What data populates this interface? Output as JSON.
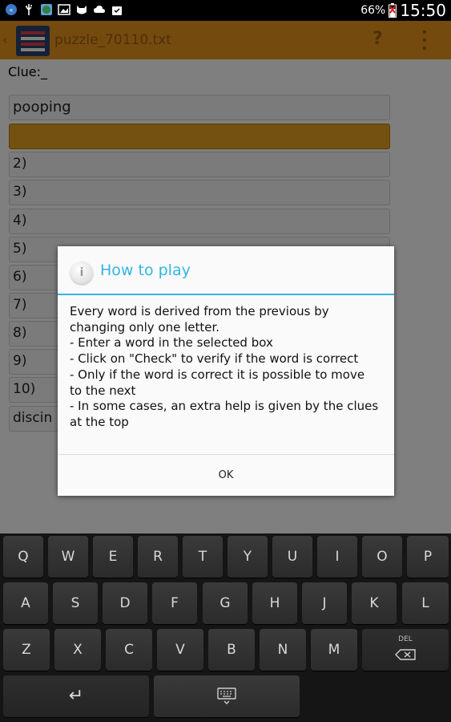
{
  "status_bar": {
    "battery_percent": "66%",
    "time": "15:50"
  },
  "action_bar": {
    "title": "puzzle_70110.txt",
    "help_label": "?"
  },
  "clue": {
    "label": "Clue:_"
  },
  "words": [
    {
      "text": "pooping"
    },
    {
      "text": ""
    },
    {
      "text": "2)"
    },
    {
      "text": "3)"
    },
    {
      "text": "4)"
    },
    {
      "text": "5)"
    },
    {
      "text": "6)"
    },
    {
      "text": "7)"
    },
    {
      "text": "8)"
    },
    {
      "text": "9)"
    },
    {
      "text": "10)"
    },
    {
      "text": "discin"
    }
  ],
  "dialog": {
    "title": "How to play",
    "body_lines": [
      "Every word is derived from the previous by",
      "changing only one letter.",
      "- Enter a word in the selected box",
      "- Click on \"Check\" to verify if the word is correct",
      "- Only if the word is correct it is possible to move",
      "to the next",
      "- In some cases, an extra help is given by the clues",
      "at the top"
    ],
    "ok_label": "OK",
    "accent_color": "#33b5e5"
  },
  "keyboard": {
    "row1": [
      "Q",
      "W",
      "E",
      "R",
      "T",
      "Y",
      "U",
      "I",
      "O",
      "P"
    ],
    "row2": [
      "A",
      "S",
      "D",
      "F",
      "G",
      "H",
      "J",
      "K",
      "L"
    ],
    "row3": [
      "Z",
      "X",
      "C",
      "V",
      "B",
      "N",
      "M"
    ],
    "delete_label": "DEL",
    "enter_symbol": "↵"
  },
  "colors": {
    "action_bar": "#e8941f",
    "selected_box": "#e8a321"
  }
}
